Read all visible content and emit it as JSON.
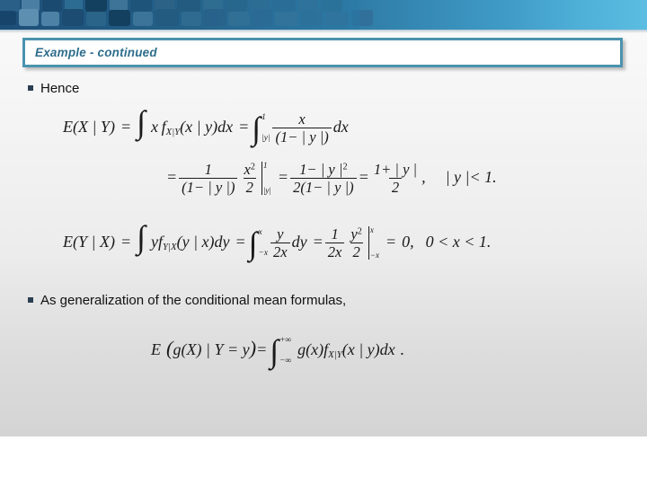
{
  "slide": {
    "title": "Example - continued",
    "background_color": "#ececec",
    "accent_color": "#4b93ae",
    "title_text_color": "#2e6d8c",
    "bullet_color": "#2b3f52"
  },
  "banner": {
    "gradient_from": "#1d4f77",
    "gradient_to": "#5cbde2",
    "pattern": "rounded-square-mosaic"
  },
  "bullets": [
    {
      "marker": "square-bullet",
      "label": "Hence"
    },
    {
      "marker": "square-bullet",
      "label": "As generalization of the conditional mean formulas,"
    }
  ],
  "equations": [
    {
      "id": "conditional-mean-x-given-y",
      "plain": "E(X | Y) = ∫ x f_{X|Y}(x | y) dx = ∫_{|y|}^{1} x / (1 - |y|) dx",
      "parts": {
        "lhs": "E(X | Y)",
        "eq1": "=",
        "integral_1": "∫",
        "integrand_1": "x f_{X|Y}(x | y) dx",
        "eq2": "=",
        "integral_2_lower": "|y|",
        "integral_2_upper": "1",
        "numerator": "x",
        "denominator": "(1− | y |)",
        "differential": "dx"
      }
    },
    {
      "id": "conditional-mean-x-given-y-result",
      "plain": "= 1/(1-|y|) · x²/2 |_{|y|}^{1} = (1-|y|²)/(2(1-|y|)) = (1+|y|)/2 ,  |y| < 1.",
      "parts": {
        "eq1": "=",
        "frac1_num": "1",
        "frac1_den": "(1− | y |)",
        "frac2_num": "x",
        "frac2_num_exp": "2",
        "frac2_den": "2",
        "eval_upper": "1",
        "eval_lower": "|y|",
        "eq2": "=",
        "frac3_num": "1− | y |",
        "frac3_num_exp": "2",
        "frac3_den": "2(1− | y |)",
        "eq3": "=",
        "frac4_num": "1+ | y |",
        "frac4_den": "2",
        "comma": ",",
        "condition": "| y |< 1."
      }
    },
    {
      "id": "conditional-mean-y-given-x",
      "plain": "E(Y | X) = ∫ y f_{Y|X}(y | x) dy = ∫_{-x}^{x} y/(2x) dy = 1/(2x) · y²/2 |_{-x}^{x} = 0,  0 < x < 1.",
      "parts": {
        "lhs": "E(Y | X)",
        "eq1": "=",
        "integral_1": "∫",
        "integrand_1": "yf_{Y|X}(y | x) dy",
        "eq2": "=",
        "integral_2_lower": "−x",
        "integral_2_upper": "x",
        "frac1_num": "y",
        "frac1_den": "2x",
        "differential": "dy",
        "eq3": "=",
        "frac2_num": "1",
        "frac2_den": "2x",
        "frac3_num": "y",
        "frac3_num_exp": "2",
        "frac3_den": "2",
        "eval_upper": "x",
        "eval_lower": "−x",
        "eq4": "=",
        "result": "0,",
        "condition": "0 < x < 1."
      }
    },
    {
      "id": "generalized-conditional-mean",
      "plain": "E(g(X) | Y = y) = ∫_{-∞}^{+∞} g(x) f_{X|Y}(x | y) dx .",
      "parts": {
        "lhs_open": "E",
        "lhs_body": "(g(X) | Y = y)",
        "eq1": "=",
        "integral_lower": "−∞",
        "integral_upper": "+∞",
        "integrand": "g(x) f_{X|Y}(x | y) dx",
        "period": "."
      }
    }
  ]
}
